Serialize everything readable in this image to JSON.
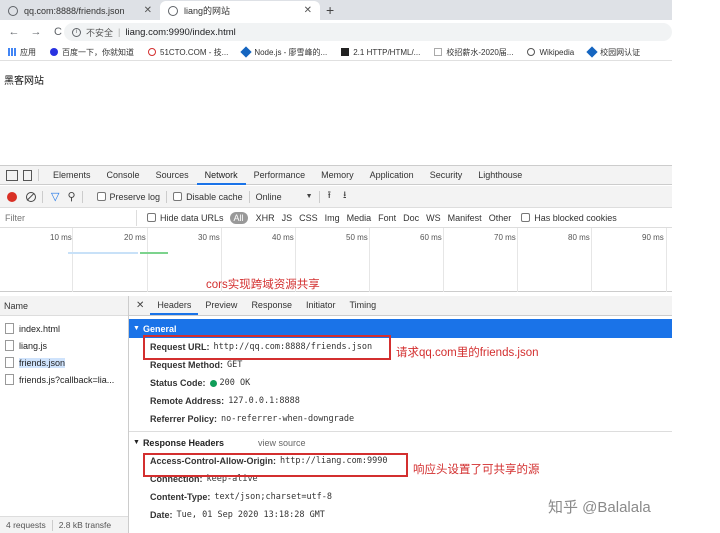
{
  "browser": {
    "tabs": [
      {
        "title": "qq.com:8888/friends.json",
        "active": false
      },
      {
        "title": "liang的网站",
        "active": true
      }
    ],
    "new_tab": "+",
    "close": "✕",
    "nav": {
      "back": "←",
      "forward": "→",
      "reload": "C"
    },
    "address": {
      "security": "不安全",
      "separator": "|",
      "url": "liang.com:9990/index.html"
    },
    "bookmarks": [
      "应用",
      "百度一下，你就知道",
      "51CTO.COM - 技...",
      "Node.js - 廖雪峰的...",
      "2.1 HTTP/HTML/...",
      "校招薪水-2020届...",
      "Wikipedia",
      "校园网认证"
    ]
  },
  "page": {
    "text": "黑客网站"
  },
  "devtools": {
    "tabs": [
      "Elements",
      "Console",
      "Sources",
      "Network",
      "Performance",
      "Memory",
      "Application",
      "Security",
      "Lighthouse"
    ],
    "active_tab": "Network",
    "controls": {
      "preserve_log": "Preserve log",
      "disable_cache": "Disable cache",
      "throttle": "Online"
    },
    "filter": {
      "placeholder": "Filter",
      "hide_data_urls": "Hide data URLs",
      "all": "All",
      "types": [
        "XHR",
        "JS",
        "CSS",
        "Img",
        "Media",
        "Font",
        "Doc",
        "WS",
        "Manifest",
        "Other"
      ],
      "blocked_cookies": "Has blocked cookies"
    },
    "timeline_ticks": [
      "10 ms",
      "20 ms",
      "30 ms",
      "40 ms",
      "50 ms",
      "60 ms",
      "70 ms",
      "80 ms",
      "90 ms"
    ],
    "requests": {
      "header": "Name",
      "files": [
        "index.html",
        "liang.js",
        "friends.json",
        "friends.js?callback=lia..."
      ],
      "status": {
        "count": "4 requests",
        "size": "2.8 kB transfe"
      }
    },
    "detail": {
      "tabs": [
        "Headers",
        "Preview",
        "Response",
        "Initiator",
        "Timing"
      ],
      "active_tab": "Headers",
      "general": {
        "title": "General",
        "rows": [
          {
            "k": "Request URL:",
            "v": "http://qq.com:8888/friends.json"
          },
          {
            "k": "Request Method:",
            "v": "GET"
          },
          {
            "k": "Status Code:",
            "v": "200 OK"
          },
          {
            "k": "Remote Address:",
            "v": "127.0.0.1:8888"
          },
          {
            "k": "Referrer Policy:",
            "v": "no-referrer-when-downgrade"
          }
        ]
      },
      "response_headers": {
        "title": "Response Headers",
        "view_source": "view source",
        "rows": [
          {
            "k": "Access-Control-Allow-Origin:",
            "v": "http://liang.com:9990"
          },
          {
            "k": "Connection:",
            "v": "keep-alive"
          },
          {
            "k": "Content-Type:",
            "v": "text/json;charset=utf-8"
          },
          {
            "k": "Date:",
            "v": "Tue, 01 Sep 2020 13:18:28 GMT"
          }
        ]
      }
    }
  },
  "annotations": {
    "cors": "cors实现跨域资源共享",
    "request": "请求qq.com里的friends.json",
    "response": "响应头设置了可共享的源"
  },
  "watermark": "知乎 @Balalala",
  "colors": {
    "annotation": "#d32f2f",
    "selected": "#1a73e8",
    "status_ok": "#0f9d58",
    "record": "#d93025"
  }
}
